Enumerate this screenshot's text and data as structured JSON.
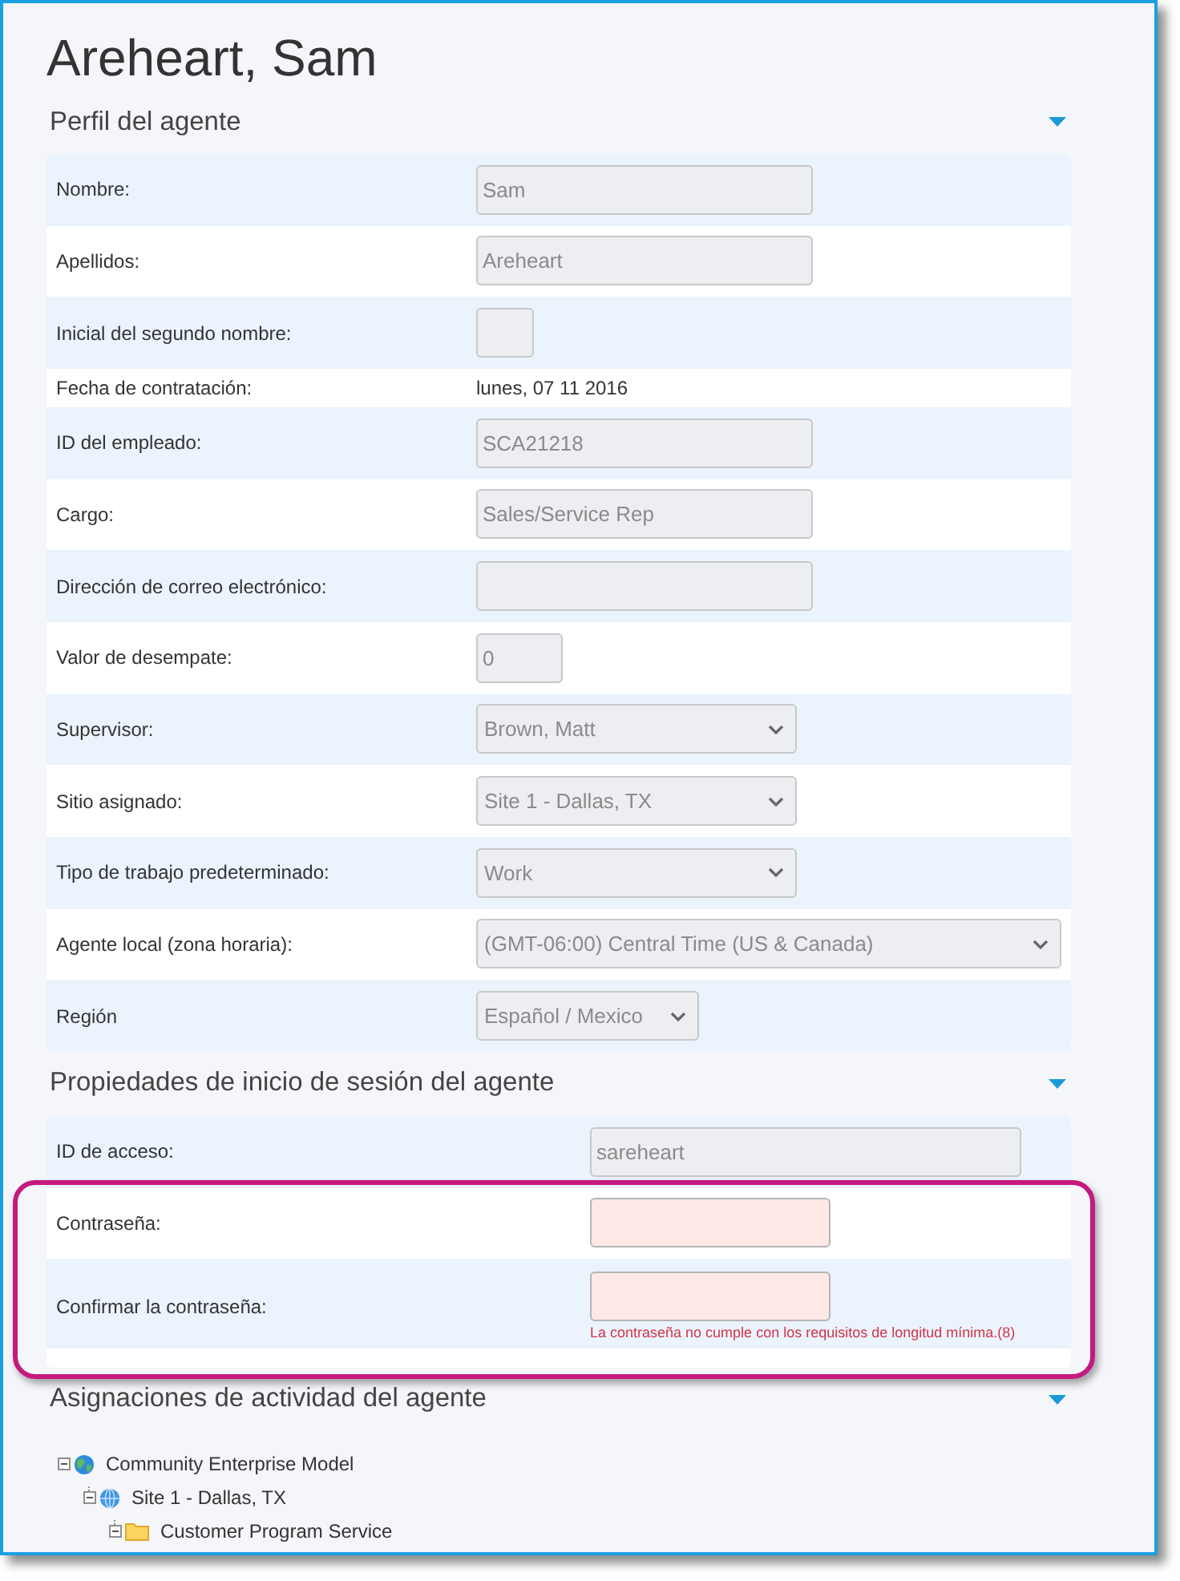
{
  "window": {
    "title": "Areheart, Sam"
  },
  "sections": [
    {
      "title": "Perfil del agente",
      "kind": "profile",
      "expanded": true,
      "rows": [
        {
          "label": "Nombre:",
          "kind": "text",
          "value": "Sam",
          "disabled": true
        },
        {
          "label": "Apellidos:",
          "kind": "text",
          "value": "Areheart",
          "disabled": true
        },
        {
          "label": "Inicial del segundo nombre:",
          "kind": "initial",
          "disabled": true
        },
        {
          "label": "Fecha de contratación:",
          "kind": "date",
          "value": "lunes, 07 11 2016"
        },
        {
          "label": "ID del empleado:",
          "kind": "text",
          "value": "SCA21218",
          "disabled": true
        },
        {
          "label": "Cargo:",
          "kind": "text",
          "value": "Sales/Service Rep",
          "disabled": true
        },
        {
          "label": "Dirección de correo electrónico:",
          "kind": "text",
          "disabled": true
        },
        {
          "label": "Valor de desempate:",
          "kind": "number",
          "value": "0",
          "disabled": true
        },
        {
          "label": "Supervisor:",
          "kind": "select",
          "value": "Brown, Matt",
          "disabled": true
        },
        {
          "label": "Sitio asignado:",
          "kind": "select",
          "value": "Site 1 - Dallas, TX",
          "disabled": true
        },
        {
          "label": "Tipo de trabajo predeterminado:",
          "kind": "select",
          "value": "Work",
          "disabled": true
        },
        {
          "label": "Agente local (zona horaria):",
          "kind": "timezone",
          "value": "(GMT-06:00) Central Time (US & Canada)",
          "disabled": true
        },
        {
          "label": "Región",
          "kind": "locale",
          "value": "Español / Mexico",
          "disabled": true
        }
      ]
    },
    {
      "title": "Propiedades de inicio de sesión del agente",
      "kind": "login",
      "expanded": true,
      "rows": [
        {
          "label": "ID de acceso:",
          "kind": "text",
          "value": "sareheart",
          "disabled": true,
          "invalid": false,
          "highlighted": false
        },
        {
          "label": "Contraseña:",
          "kind": "password",
          "disabled": false,
          "invalid": true,
          "highlighted": true
        },
        {
          "label": "Confirmar la contraseña:",
          "kind": "password",
          "disabled": false,
          "invalid": true,
          "highlighted": true,
          "error": "La contraseña no cumple con los requisitos de longitud mínima.(8)"
        }
      ]
    },
    {
      "title": "Asignaciones de actividad del agente",
      "kind": "tree",
      "expanded": true,
      "tree": [
        {
          "label": "Community Enterprise Model",
          "kind": "enterprise",
          "expanded": true,
          "children": [
            {
              "label": "Site 1 - Dallas, TX",
              "kind": "site",
              "expanded": true,
              "children": [
                {
                  "label": "Customer Program Service",
                  "kind": "folder",
                  "expanded": true
                }
              ]
            }
          ]
        }
      ]
    }
  ]
}
